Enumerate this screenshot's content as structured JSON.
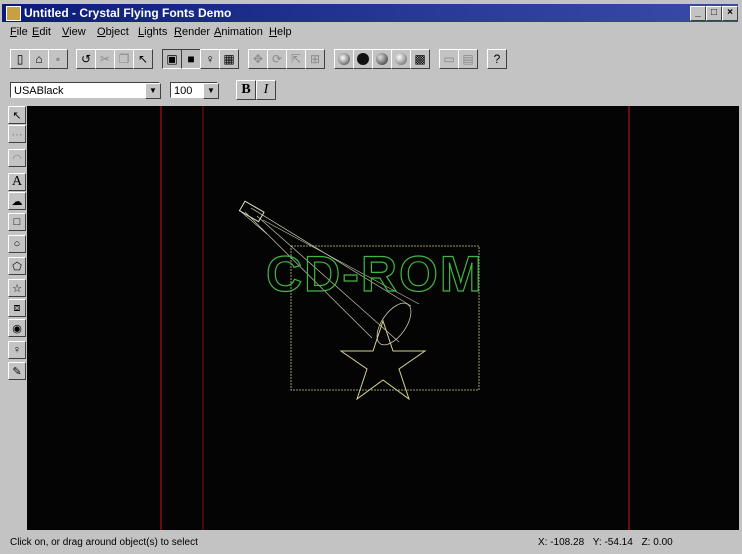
{
  "window": {
    "title": "Untitled - Crystal Flying Fonts Demo",
    "controls": [
      "_",
      "□",
      "×"
    ]
  },
  "menu": [
    {
      "label": "File",
      "mnemonic": "F",
      "rest": "ile"
    },
    {
      "label": "Edit",
      "mnemonic": "E",
      "rest": "dit"
    },
    {
      "label": "View",
      "mnemonic": "V",
      "rest": "iew"
    },
    {
      "label": "Object",
      "mnemonic": "O",
      "rest": "bject"
    },
    {
      "label": "Lights",
      "mnemonic": "L",
      "rest": "ights"
    },
    {
      "label": "Render",
      "mnemonic": "R",
      "rest": "ender"
    },
    {
      "label": "Animation",
      "mnemonic": "A",
      "rest": "nimation"
    },
    {
      "label": "Help",
      "mnemonic": "H",
      "rest": "elp"
    }
  ],
  "toolbar": {
    "icons": [
      "new-file-icon",
      "open-file-icon",
      "save-icon",
      "undo-icon",
      "cut-icon",
      "copy-icon",
      "paste-icon",
      "window-icon",
      "frame-icon",
      "bulb-icon",
      "grid-icon",
      "move-icon",
      "rotate-icon",
      "scale-icon",
      "align-icon",
      "render-wire-icon",
      "render-flat-icon",
      "render-smooth-icon",
      "render-full-icon",
      "render-scene-icon",
      "camera-icon",
      "film-icon",
      "context-help-icon"
    ]
  },
  "fontbar": {
    "font_name": "USABlack",
    "font_size": "100",
    "bold_label": "B",
    "italic_label": "I"
  },
  "tools": [
    "select-arrow-icon",
    "edit-points-icon",
    "lathe-icon",
    "text-tool-icon",
    "extrude-icon",
    "rectangle-tool-icon",
    "ellipse-tool-icon",
    "polygon-tool-icon",
    "star-tool-icon",
    "cube-tool-icon",
    "sphere-tool-icon",
    "light-tool-icon",
    "paint-tool-icon"
  ],
  "canvas": {
    "text_object": "CD-ROM",
    "text_color": "#3fb83f",
    "wire_color": "#c8c890",
    "guide_color": "#8a1010",
    "background": "#040404"
  },
  "status": {
    "message": "Click on, or drag around object(s) to select",
    "x": "X: -108.28",
    "y": "Y: -54.14",
    "z": "Z: 0.00"
  }
}
